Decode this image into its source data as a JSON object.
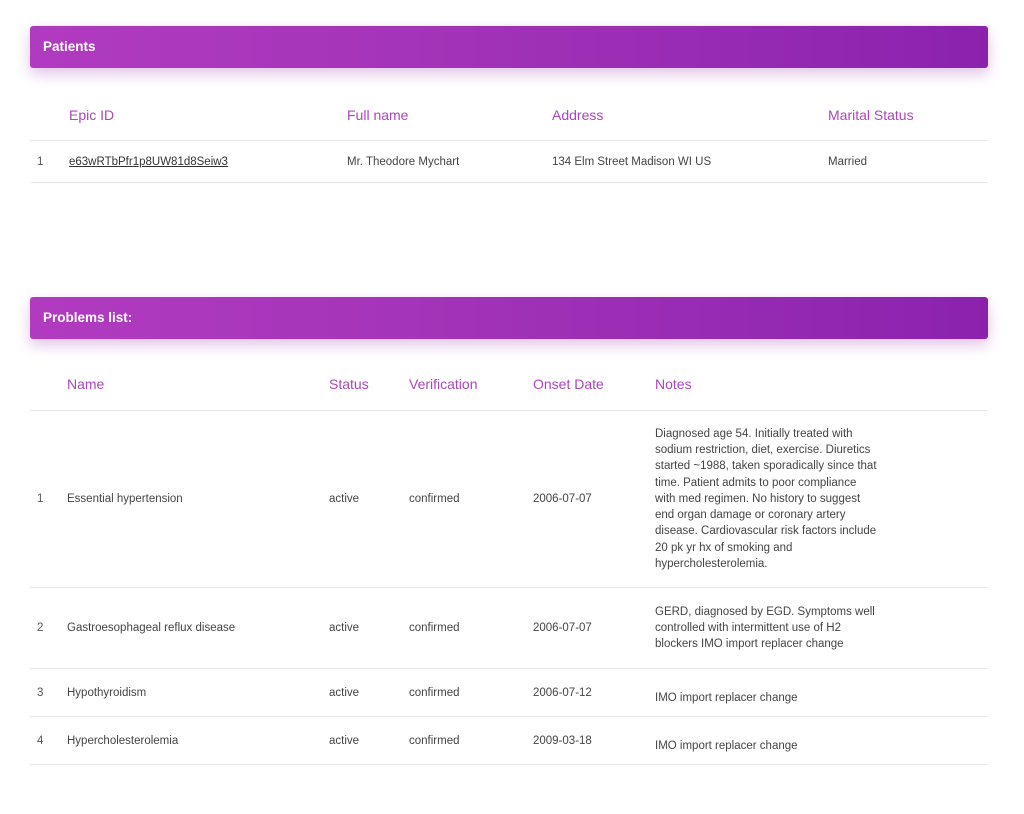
{
  "patients_section": {
    "title": "Patients",
    "columns": [
      "Epic ID",
      "Full name",
      "Address",
      "Marital Status"
    ],
    "rows": [
      {
        "index": "1",
        "epic_id": "e63wRTbPfr1p8UW81d8Seiw3",
        "full_name": "Mr. Theodore Mychart",
        "address": "134 Elm Street Madison WI US",
        "marital_status": "Married"
      }
    ]
  },
  "problems_section": {
    "title": "Problems list:",
    "columns": [
      "Name",
      "Status",
      "Verification",
      "Onset Date",
      "Notes"
    ],
    "rows": [
      {
        "index": "1",
        "name": "Essential hypertension",
        "status": "active",
        "verification": "confirmed",
        "onset_date": "2006-07-07",
        "notes": "Diagnosed age 54. Initially treated with sodium restriction, diet, exercise. Diuretics started ~1988, taken sporadically since that time. Patient admits to poor compliance with med regimen. No history to suggest end organ damage or coronary artery disease. Cardiovascular risk factors include 20 pk yr hx of smoking and hypercholesterolemia."
      },
      {
        "index": "2",
        "name": "Gastroesophageal reflux disease",
        "status": "active",
        "verification": "confirmed",
        "onset_date": "2006-07-07",
        "notes": "GERD, diagnosed by EGD. Symptoms well controlled with intermittent use of H2 blockers IMO import replacer change"
      },
      {
        "index": "3",
        "name": "Hypothyroidism",
        "status": "active",
        "verification": "confirmed",
        "onset_date": "2006-07-12",
        "notes": "IMO import replacer change"
      },
      {
        "index": "4",
        "name": "Hypercholesterolemia",
        "status": "active",
        "verification": "confirmed",
        "onset_date": "2009-03-18",
        "notes": "IMO import replacer change"
      }
    ]
  },
  "colors": {
    "header_gradient_start": "#b13bc0",
    "header_gradient_end": "#8b22ae",
    "column_header_text": "#ab47bc",
    "row_divider": "#e6e6e6"
  }
}
